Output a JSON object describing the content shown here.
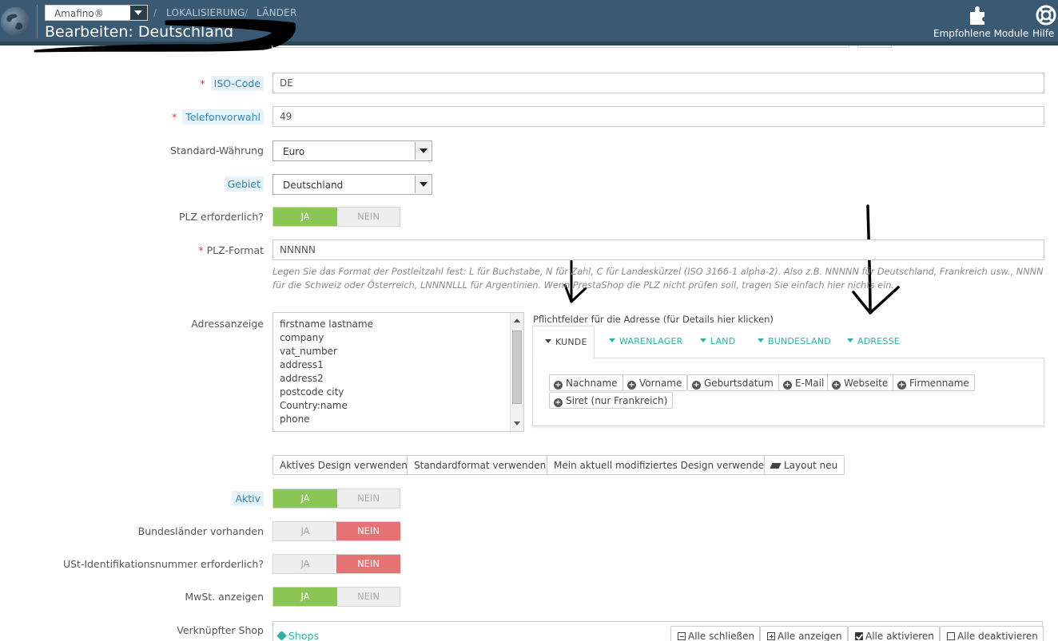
{
  "header": {
    "shop_selector": "Amafino®",
    "breadcrumb": [
      "LOKALISIERUNG",
      "LÄNDER"
    ],
    "title": "Bearbeiten: Deutschland",
    "toolbar": [
      {
        "label": "Empfohlene Module",
        "icon": "puzzle-icon"
      },
      {
        "label": "Hilfe",
        "icon": "lifebuoy-icon"
      }
    ]
  },
  "form": {
    "iso_code": {
      "label": "ISO-Code",
      "value": "DE"
    },
    "phone_prefix": {
      "label": "Telefonvorwahl",
      "value": "49"
    },
    "currency": {
      "label": "Standard-Währung",
      "value": "Euro"
    },
    "zone": {
      "label": "Gebiet",
      "value": "Deutschland"
    },
    "zip_required": {
      "label": "PLZ erforderlich?",
      "yes": "JA",
      "no": "NEIN",
      "value": "yes"
    },
    "zip_format": {
      "label": "PLZ-Format",
      "value": "NNNNN",
      "help": "Legen Sie das Format der Postleitzahl fest: L für Buchstabe, N für Zahl, C für Landeskürzel (ISO 3166-1 alpha-2). Also z.B. NNNNN für Deutschland, Frankreich usw., NNNN für die Schweiz oder Österreich, LNNNNLLL für Argentinien. Wenn PrestaShop die PLZ nicht prüfen soll, tragen Sie einfach hier nichts ein."
    },
    "address_layout": {
      "label": "Adressanzeige",
      "lines": [
        "firstname lastname",
        "company",
        "vat_number",
        "address1",
        "address2",
        "postcode city",
        "Country:name",
        "phone"
      ]
    },
    "required_fields": {
      "title": "Pflichtfelder für die Adresse (für Details hier klicken)",
      "tabs": [
        "KUNDE",
        "WARENLAGER",
        "LAND",
        "BUNDESLAND",
        "ADRESSE"
      ],
      "active_tab": "KUNDE",
      "chips": [
        "Nachname",
        "Vorname",
        "Geburtsdatum",
        "E-Mail",
        "Webseite",
        "Firmenname",
        "Siret (nur Frankreich)"
      ]
    },
    "layout_buttons": [
      "Aktives Design verwenden",
      "Standardformat verwenden",
      "Mein aktuell modifiziertes Design verwenden",
      "Layout neu"
    ],
    "active": {
      "label": "Aktiv",
      "yes": "JA",
      "no": "NEIN",
      "value": "yes"
    },
    "states": {
      "label": "Bundesländer vorhanden",
      "yes": "JA",
      "no": "NEIN",
      "value": "no"
    },
    "vat_required": {
      "label": "USt-Identifikationsnummer erforderlich?",
      "yes": "JA",
      "no": "NEIN",
      "value": "no"
    },
    "display_tax": {
      "label": "MwSt. anzeigen",
      "yes": "JA",
      "no": "NEIN",
      "value": "yes"
    },
    "shops": {
      "label": "Verknüpfter Shop",
      "link": "Shops",
      "buttons": [
        "Alle schließen",
        "Alle anzeigen",
        "Alle aktivieren",
        "Alle deaktivieren"
      ]
    }
  },
  "colors": {
    "header": "#3a5a73",
    "switch_on": "#8ac653",
    "switch_off": "#e57373",
    "tab_accent": "#28b5a5",
    "label_highlight": "#3786b6"
  }
}
